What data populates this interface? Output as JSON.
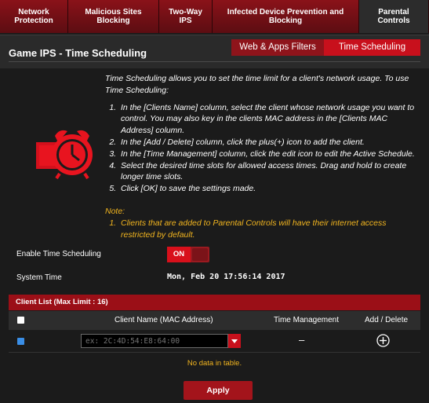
{
  "tabs": [
    {
      "label": "Network\nProtection"
    },
    {
      "label": "Malicious Sites\nBlocking"
    },
    {
      "label": "Two-Way\nIPS"
    },
    {
      "label": "Infected Device Prevention and\nBlocking"
    },
    {
      "label": "Parental\nControls"
    }
  ],
  "header": {
    "title": "Game IPS - Time Scheduling",
    "subtabs": [
      {
        "label": "Web & Apps Filters"
      },
      {
        "label": "Time Scheduling"
      }
    ]
  },
  "description": {
    "intro": "Time Scheduling allows you to set the time limit for a client's network usage. To use Time Scheduling:",
    "steps": [
      "In the [Clients Name] column, select the client whose network usage you want to control. You may also key in the clients MAC address in the [Clients MAC Address] column.",
      "In the [Add / Delete] column, click the plus(+) icon to add the client.",
      "In the [Time Management] column, click the edit icon to edit the Active Schedule.",
      "Select the desired time slots for allowed access times. Drag and hold to create longer time slots.",
      "Click [OK] to save the settings made."
    ]
  },
  "note": {
    "heading": "Note:",
    "items": [
      "Clients that are added to Parental Controls will have their internet access restricted by default."
    ]
  },
  "settings": {
    "enable_label": "Enable Time Scheduling",
    "toggle_label": "ON",
    "system_time_label": "System Time",
    "system_time_value": "Mon, Feb 20 17:56:14 2017"
  },
  "client_list": {
    "title": "Client List (Max Limit : 16)",
    "columns": [
      "Client Name (MAC Address)",
      "Time Management",
      "Add / Delete"
    ],
    "mac_placeholder": "ex: 2C:4D:54:E8:64:00",
    "time_value": "–",
    "empty_text": "No data in table."
  },
  "apply_label": "Apply",
  "colors": {
    "accent": "#c8101c",
    "tab_bg": "#8a1219",
    "note": "#f2b51f",
    "background": "#1b1b1b"
  }
}
